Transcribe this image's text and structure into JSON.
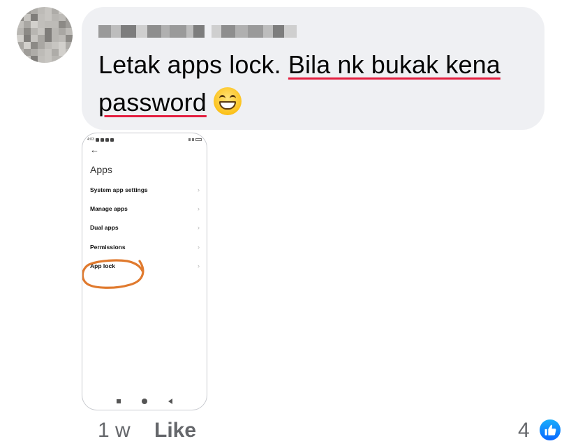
{
  "comment": {
    "author_name": "",
    "text_plain": "Letak apps lock. ",
    "text_underlined": "Bila nk bukak kena",
    "text_line2_underlined": "password",
    "emoji": "grinning-face-with-smiling-eyes"
  },
  "attachment": {
    "title": "Apps",
    "back_icon": "arrow-left-icon",
    "menu": [
      {
        "label": "System app settings",
        "chevron": "›"
      },
      {
        "label": "Manage apps",
        "chevron": "›"
      },
      {
        "label": "Dual apps",
        "chevron": "›"
      },
      {
        "label": "Permissions",
        "chevron": "›"
      },
      {
        "label": "App lock",
        "chevron": "›"
      }
    ],
    "annotation_color": "#e07a2e",
    "status_time": "4:03"
  },
  "footer": {
    "time": "1 w",
    "like_label": "Like",
    "reaction_count": "4",
    "reaction_icon": "thumbs-up-icon"
  },
  "colors": {
    "bubble_bg": "#eff0f3",
    "spellcheck_underline": "#e41e3f",
    "meta_text": "#65676b",
    "like_blue": "#0866ff"
  }
}
